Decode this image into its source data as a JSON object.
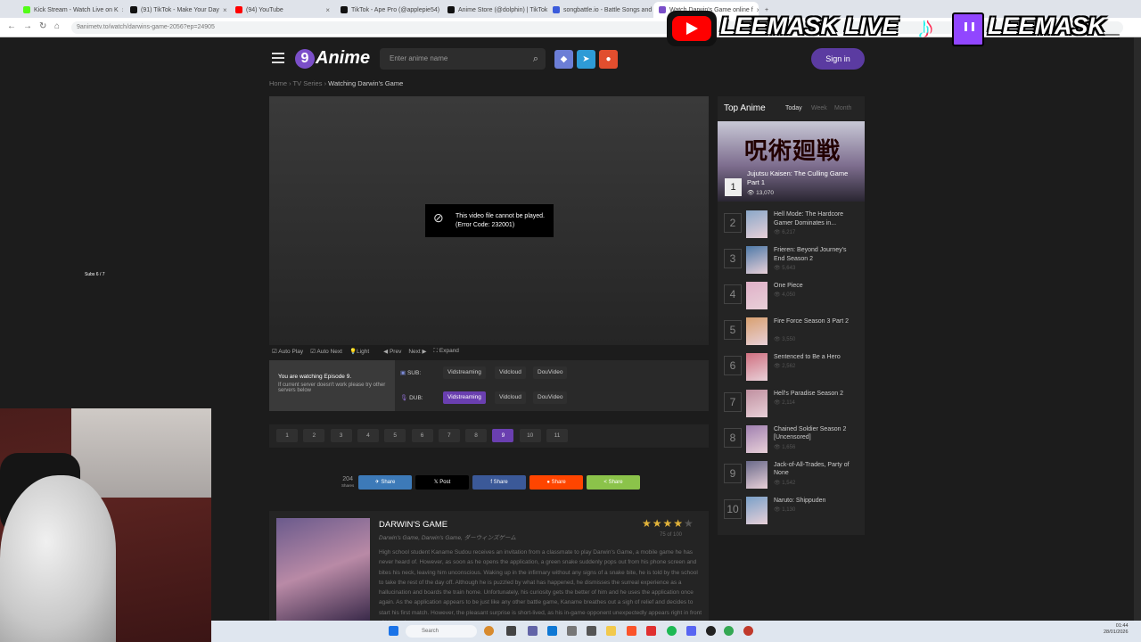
{
  "browser": {
    "tabs": [
      {
        "label": "Kick Stream - Watch Live on K",
        "color": "#53fc18"
      },
      {
        "label": "(91) TikTok - Make Your Day",
        "color": "#111111"
      },
      {
        "label": "(94) YouTube",
        "color": "#ff0000"
      },
      {
        "label": "TikTok - Ape Pro (@applepie54)",
        "color": "#111111"
      },
      {
        "label": "Anime Store (@dolphin) | TikTok",
        "color": "#111111"
      },
      {
        "label": "songbattle.io - Battle Songs and",
        "color": "#3b5bdb"
      },
      {
        "label": "Watch Darwin's Game online f",
        "color": "#7b4fc9"
      }
    ],
    "new_tab": "+",
    "url": "9animetv.to/watch/darwins-game-2056?ep=24905"
  },
  "site": {
    "logo_number": "9",
    "logo_text": "Anime",
    "search_placeholder": "Enter anime name",
    "sign_in": "Sign in",
    "breadcrumb": {
      "home": "Home",
      "series": "TV Series",
      "current": "Watching Darwin's Game"
    }
  },
  "player": {
    "error_line1": "This video file cannot be played.",
    "error_line2": "(Error Code: 232001)",
    "controls": {
      "autoplay": "Auto Play",
      "autonext": "Auto Next",
      "light": "Light",
      "prev": "Prev",
      "next": "Next",
      "expand": "Expand"
    }
  },
  "servers": {
    "watching": "You are watching Episode 9.",
    "hint": "If current server doesn't work please try other servers below",
    "sub_label": "SUB:",
    "dub_label": "DUB:",
    "sub": [
      "Vidstreaming",
      "Vidcloud",
      "DouVideo"
    ],
    "dub": [
      "Vidstreaming",
      "Vidcloud",
      "DouVideo"
    ]
  },
  "episodes": [
    "1",
    "2",
    "3",
    "4",
    "5",
    "6",
    "7",
    "8",
    "9",
    "10",
    "11"
  ],
  "active_episode": "9",
  "share": {
    "count": "204",
    "count_label": "Shares",
    "buttons": [
      {
        "label": "Share",
        "color": "#3d7ab8"
      },
      {
        "label": "Post",
        "color": "#000000"
      },
      {
        "label": "Share",
        "color": "#3b5998"
      },
      {
        "label": "Share",
        "color": "#ff4500"
      },
      {
        "label": "Share",
        "color": "#8bc34a"
      }
    ]
  },
  "anime": {
    "title": "DARWIN'S GAME",
    "alt_names": "Darwin's Game, Darwin's Game, ダーウィンズゲーム",
    "stars": "★★★★",
    "star_off": "★",
    "rating": "75 of 100",
    "description": "High school student Kaname Sudou receives an invitation from a classmate to play Darwin's Game, a mobile game he has never heard of. However, as soon as he opens the application, a green snake suddenly pops out from his phone screen and bites his neck, leaving him unconscious. Waking up in the infirmary without any signs of a snake bite, he is told by the school to take the rest of the day off. Although he is puzzled by what has happened, he dismisses the surreal experience as a hallucination and boards the train home. Unfortunately, his curiosity gets the better of him and he uses the application once again. As the application appears to be just like any other battle game, Kaname breathes out a sigh of relief and decides to start his first match. However, the pleasant surprise is short-lived, as his in-game opponent unexpectedly appears right in front of him and"
  },
  "top_anime": {
    "heading": "Top Anime",
    "tabs": [
      "Today",
      "Week",
      "Month"
    ],
    "featured": {
      "rank": "1",
      "title": "Jujutsu Kaisen: The Culling Game Part 1",
      "views": "13,070",
      "kanji": "呪術廻戦"
    },
    "items": [
      {
        "rank": "2",
        "title": "Hell Mode: The Hardcore Gamer Dominates in...",
        "views": "6,217"
      },
      {
        "rank": "3",
        "title": "Frieren: Beyond Journey's End Season 2",
        "views": "5,643"
      },
      {
        "rank": "4",
        "title": "One Piece",
        "views": "4,050"
      },
      {
        "rank": "5",
        "title": "Fire Force Season 3 Part 2",
        "views": "3,550"
      },
      {
        "rank": "6",
        "title": "Sentenced to Be a Hero",
        "views": "2,562"
      },
      {
        "rank": "7",
        "title": "Hell's Paradise Season 2",
        "views": "2,114"
      },
      {
        "rank": "8",
        "title": "Chained Soldier Season 2 [Uncensored]",
        "views": "1,656"
      },
      {
        "rank": "9",
        "title": "Jack-of-All-Trades, Party of None",
        "views": "1,542"
      },
      {
        "rank": "10",
        "title": "Naruto: Shippuden",
        "views": "1,130"
      }
    ]
  },
  "overlay": {
    "youtube_text": "LEEMASK LIVE",
    "twitch_text": "LEEMASK_",
    "subs": "Subs 6 / 7"
  },
  "taskbar": {
    "search": "Search",
    "time": "01:44",
    "date": "28/01/2026"
  }
}
